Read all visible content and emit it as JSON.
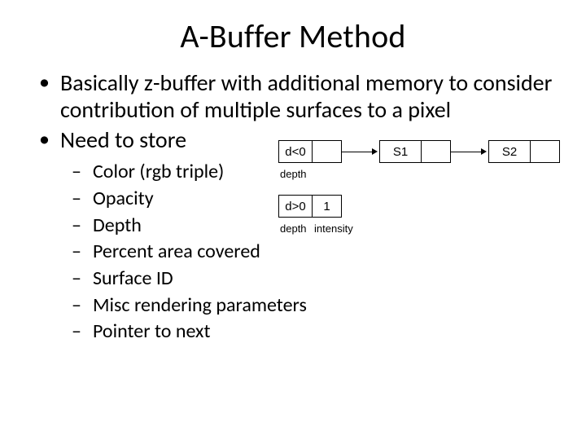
{
  "title": "A-Buffer Method",
  "bullets": [
    "Basically z-buffer with additional memory to consider contribution of multiple surfaces to a pixel",
    "Need to store"
  ],
  "sub_bullets": [
    "Color (rgb triple)",
    "Opacity",
    "Depth",
    "Percent area covered",
    "Surface ID",
    "Misc rendering parameters",
    "Pointer to next"
  ],
  "diagram": {
    "row1": {
      "cell_depth": "d<0",
      "cell_ptr": "",
      "s1": "S1",
      "s2": "S2",
      "label_depth": "depth"
    },
    "row2": {
      "cell_depth": "d>0",
      "cell_int": "1",
      "label_depth": "depth",
      "label_intensity": "intensity"
    }
  }
}
